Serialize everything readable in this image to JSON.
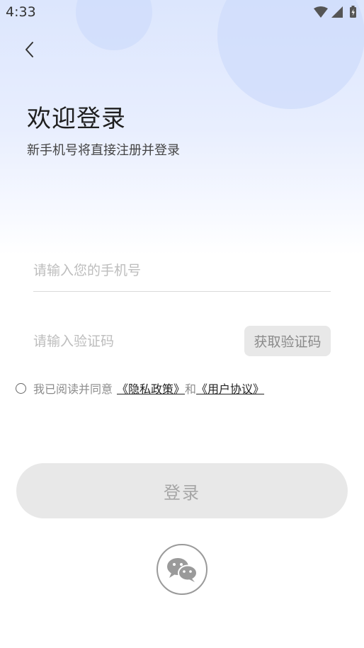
{
  "status_bar": {
    "time": "4:33"
  },
  "header": {
    "title": "欢迎登录",
    "subtitle": "新手机号将直接注册并登录"
  },
  "form": {
    "phone_placeholder": "请输入您的手机号",
    "phone_value": "",
    "code_placeholder": "请输入验证码",
    "code_value": "",
    "get_code_label": "获取验证码"
  },
  "agreement": {
    "checked": false,
    "prefix": "我已阅读并同意",
    "privacy_link": "《隐私政策》",
    "and_text": "和",
    "user_link": "《用户协议》"
  },
  "login_button_label": "登录",
  "icons": {
    "back": "chevron-left-icon",
    "wifi": "wifi-icon",
    "signal": "signal-icon",
    "battery": "battery-charging-icon",
    "wechat": "wechat-icon"
  },
  "colors": {
    "background_top": "#dce6fd",
    "bubble": "#cfdcfb",
    "disabled_button": "#e8e8e8",
    "disabled_text": "#a6a6a6"
  }
}
